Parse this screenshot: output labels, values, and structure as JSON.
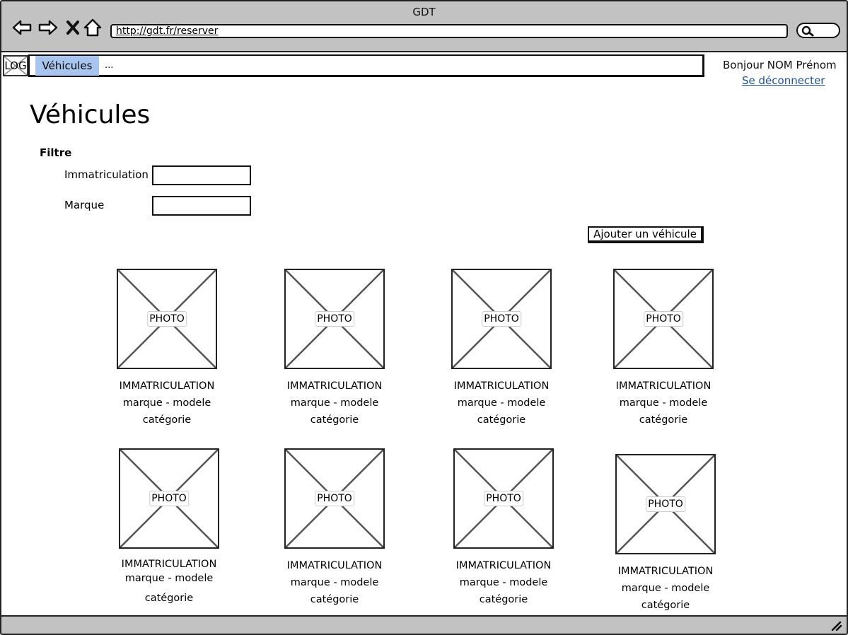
{
  "window": {
    "title": "GDT"
  },
  "browser": {
    "url": "http://gdt.fr/reserver",
    "icons": [
      "back-arrow-icon",
      "forward-arrow-icon",
      "close-x-icon",
      "home-icon",
      "search-icon"
    ]
  },
  "nav": {
    "logo": "LOG",
    "active_item": "Véhicules",
    "more": "...",
    "greeting": "Bonjour NOM Prénom",
    "logout": "Se déconnecter"
  },
  "page": {
    "title": "Véhicules",
    "filter_label": "Filtre",
    "fields": [
      {
        "label": "Immatriculation",
        "value": ""
      },
      {
        "label": "Marque",
        "value": ""
      }
    ],
    "add_button": "Ajouter un véhicule"
  },
  "vehicles": [
    {
      "photo": "PHOTO",
      "plate": "IMMATRICULATION",
      "model": "marque - modele",
      "category": "catégorie"
    },
    {
      "photo": "PHOTO",
      "plate": "IMMATRICULATION",
      "model": "marque - modele",
      "category": "catégorie"
    },
    {
      "photo": "PHOTO",
      "plate": "IMMATRICULATION",
      "model": "marque - modele",
      "category": "catégorie"
    },
    {
      "photo": "PHOTO",
      "plate": "IMMATRICULATION",
      "model": "marque - modele",
      "category": "catégorie"
    },
    {
      "photo": "PHOTO",
      "plate": "IMMATRICULATION",
      "model": "marque - modele",
      "category": "catégorie"
    },
    {
      "photo": "PHOTO",
      "plate": "IMMATRICULATION",
      "model": "marque - modele",
      "category": "catégorie"
    },
    {
      "photo": "PHOTO",
      "plate": "IMMATRICULATION",
      "model": "marque - modele",
      "category": "catégorie"
    },
    {
      "photo": "PHOTO",
      "plate": "IMMATRICULATION",
      "model": "marque - modele",
      "category": "catégorie"
    }
  ],
  "colors": {
    "chrome": "#c2c2c2",
    "active_tab": "#a8c5f0",
    "link": "#1c4fa0"
  }
}
